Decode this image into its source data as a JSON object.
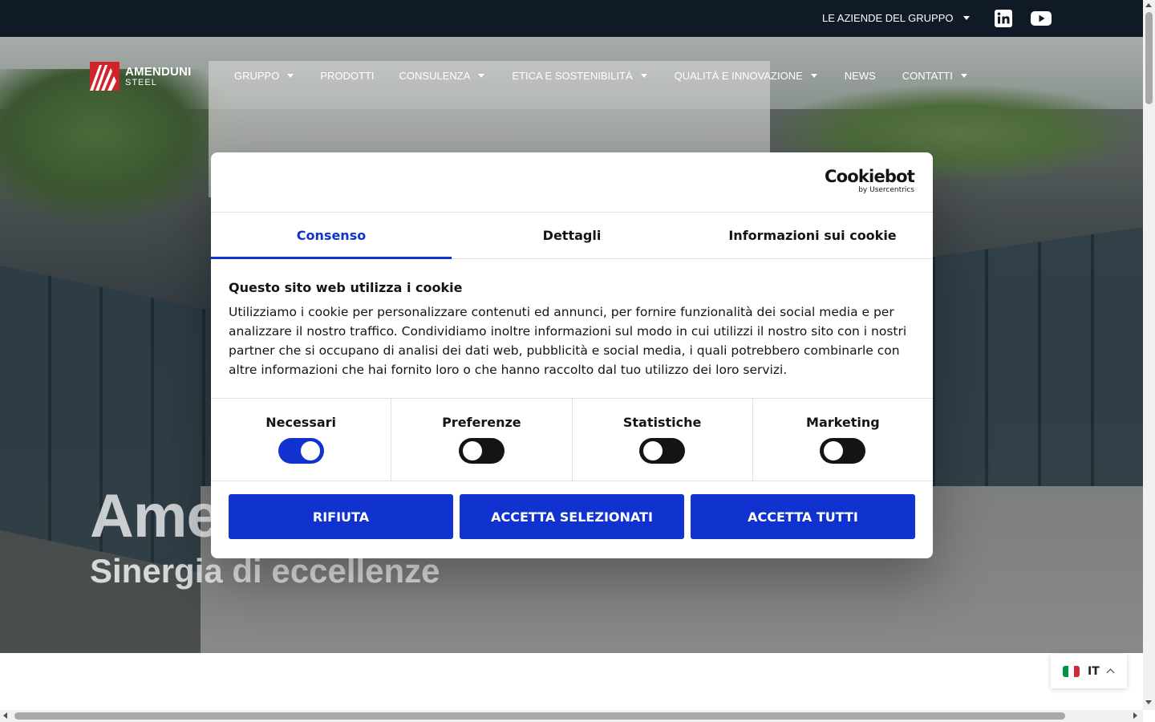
{
  "topbar": {
    "group_menu_label": "LE AZIENDE DEL GRUPPO",
    "social": [
      "linkedin-icon",
      "youtube-icon"
    ]
  },
  "logo": {
    "line1": "AMENDUNI",
    "line2": "STEEL"
  },
  "nav": {
    "items": [
      {
        "label": "GRUPPO",
        "dropdown": true
      },
      {
        "label": "PRODOTTI",
        "dropdown": false
      },
      {
        "label": "CONSULENZA",
        "dropdown": true
      },
      {
        "label": "ETICA E SOSTENIBILITÀ",
        "dropdown": true
      },
      {
        "label": "QUALITÀ E INNOVAZIONE",
        "dropdown": true
      },
      {
        "label": "NEWS",
        "dropdown": false
      },
      {
        "label": "CONTATTI",
        "dropdown": true
      }
    ]
  },
  "hero": {
    "title": "Ame",
    "subtitle": "Sinergia di eccellenze"
  },
  "cookie_dialog": {
    "brand_name": "Cookiebot",
    "brand_sub": "by Usercentrics",
    "tabs": [
      {
        "label": "Consenso",
        "active": true
      },
      {
        "label": "Dettagli",
        "active": false
      },
      {
        "label": "Informazioni sui cookie",
        "active": false
      }
    ],
    "title": "Questo sito web utilizza i cookie",
    "text": "Utilizziamo i cookie per personalizzare contenuti ed annunci, per fornire funzionalità dei social media e per analizzare il nostro traffico. Condividiamo inoltre informazioni sul modo in cui utilizzi il nostro sito con i nostri partner che si occupano di analisi dei dati web, pubblicità e social media, i quali potrebbero combinarle con altre informazioni che hai fornito loro o che hanno raccolto dal tuo utilizzo dei loro servizi.",
    "toggles": [
      {
        "label": "Necessari",
        "on": true
      },
      {
        "label": "Preferenze",
        "on": false
      },
      {
        "label": "Statistiche",
        "on": false
      },
      {
        "label": "Marketing",
        "on": false
      }
    ],
    "buttons": {
      "reject": "RIFIUTA",
      "accept_selected": "ACCETTA SELEZIONATI",
      "accept_all": "ACCETTA TUTTI"
    }
  },
  "language": {
    "code": "IT",
    "flag_colors": [
      "#009246",
      "#ffffff",
      "#ce2b37"
    ]
  },
  "colors": {
    "topbar": "#0f1a26",
    "accent_blue": "#1032cf",
    "brand_red": "#d2232a"
  }
}
